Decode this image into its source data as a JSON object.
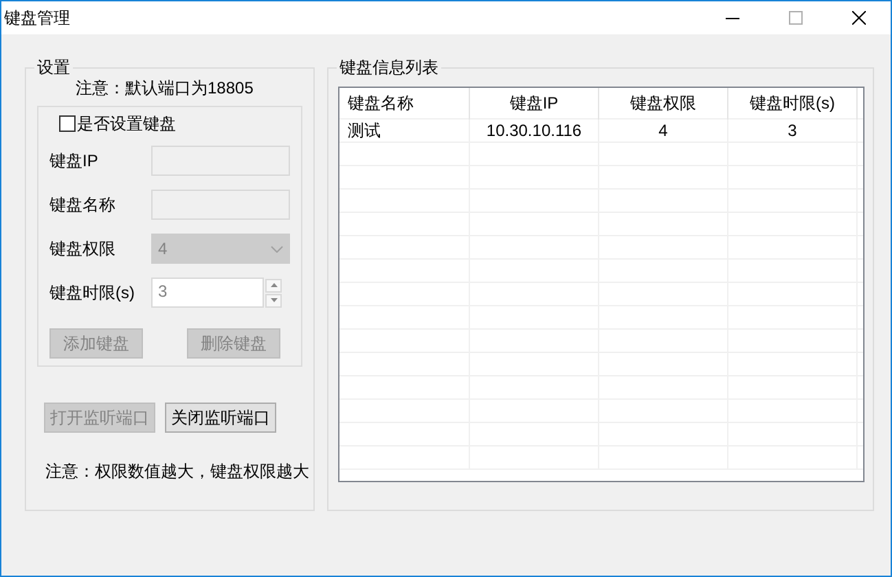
{
  "window": {
    "title": "键盘管理"
  },
  "settings": {
    "title": "设置",
    "port_note": "注意：默认端口为18805",
    "keyboard_group": {
      "checkbox": {
        "label": "是否设置键盘",
        "checked": false
      },
      "fields": [
        {
          "kind": "text",
          "label": "键盘IP",
          "disabled": true
        },
        {
          "kind": "text",
          "label": "键盘名称",
          "disabled": true
        },
        {
          "kind": "select",
          "label": "键盘权限",
          "value": "4",
          "disabled": true
        },
        {
          "kind": "spinner",
          "label": "键盘时限(s)",
          "value": "3",
          "disabled": true
        }
      ],
      "buttons": [
        {
          "label": "添加键盘",
          "disabled": true
        },
        {
          "label": "删除键盘",
          "disabled": true
        }
      ]
    },
    "port_buttons": [
      {
        "label": "打开监听端口",
        "disabled": true
      },
      {
        "label": "关闭监听端口",
        "disabled": false
      }
    ],
    "footer_note": "注意：权限数值越大，键盘权限越大"
  },
  "list": {
    "title": "键盘信息列表",
    "columns": [
      "键盘名称",
      "键盘IP",
      "键盘权限",
      "键盘时限(s)"
    ],
    "rows": [
      [
        "测试",
        "10.30.10.116",
        "4",
        "3"
      ]
    ]
  }
}
